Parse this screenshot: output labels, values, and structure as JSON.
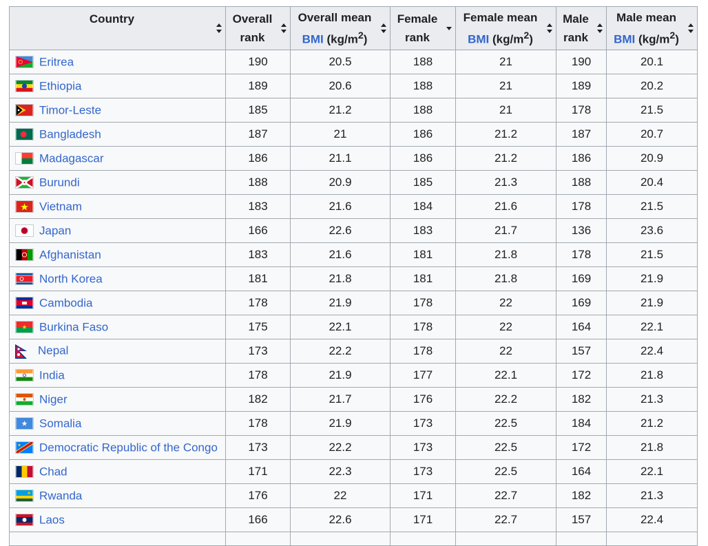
{
  "table": {
    "headers": [
      {
        "lines": [
          "Country"
        ],
        "sort": "both"
      },
      {
        "lines": [
          "Overall",
          "rank"
        ],
        "sort": "both"
      },
      {
        "lines": [
          "Overall mean"
        ],
        "bmi": true,
        "sort": "both"
      },
      {
        "lines": [
          "Female",
          "rank"
        ],
        "sort": "desc"
      },
      {
        "lines": [
          "Female mean"
        ],
        "bmi": true,
        "sort": "both"
      },
      {
        "lines": [
          "Male",
          "rank"
        ],
        "sort": "both"
      },
      {
        "lines": [
          "Male mean"
        ],
        "bmi": true,
        "sort": "both"
      }
    ],
    "bmi_link": "BMI",
    "bmi_unit": "(kg/m",
    "bmi_unit_sup": "2",
    "bmi_unit_close": ")",
    "rows": [
      {
        "country": "Eritrea",
        "flag": "eritrea-flag-icon",
        "overall_rank": "190",
        "overall_mean": "20.5",
        "female_rank": "188",
        "female_mean": "21",
        "male_rank": "190",
        "male_mean": "20.1"
      },
      {
        "country": "Ethiopia",
        "flag": "ethiopia-flag-icon",
        "overall_rank": "189",
        "overall_mean": "20.6",
        "female_rank": "188",
        "female_mean": "21",
        "male_rank": "189",
        "male_mean": "20.2"
      },
      {
        "country": "Timor-Leste",
        "flag": "timor-leste-flag-icon",
        "overall_rank": "185",
        "overall_mean": "21.2",
        "female_rank": "188",
        "female_mean": "21",
        "male_rank": "178",
        "male_mean": "21.5"
      },
      {
        "country": "Bangladesh",
        "flag": "bangladesh-flag-icon",
        "overall_rank": "187",
        "overall_mean": "21",
        "female_rank": "186",
        "female_mean": "21.2",
        "male_rank": "187",
        "male_mean": "20.7"
      },
      {
        "country": "Madagascar",
        "flag": "madagascar-flag-icon",
        "overall_rank": "186",
        "overall_mean": "21.1",
        "female_rank": "186",
        "female_mean": "21.2",
        "male_rank": "186",
        "male_mean": "20.9"
      },
      {
        "country": "Burundi",
        "flag": "burundi-flag-icon",
        "overall_rank": "188",
        "overall_mean": "20.9",
        "female_rank": "185",
        "female_mean": "21.3",
        "male_rank": "188",
        "male_mean": "20.4"
      },
      {
        "country": "Vietnam",
        "flag": "vietnam-flag-icon",
        "overall_rank": "183",
        "overall_mean": "21.6",
        "female_rank": "184",
        "female_mean": "21.6",
        "male_rank": "178",
        "male_mean": "21.5"
      },
      {
        "country": "Japan",
        "flag": "japan-flag-icon",
        "overall_rank": "166",
        "overall_mean": "22.6",
        "female_rank": "183",
        "female_mean": "21.7",
        "male_rank": "136",
        "male_mean": "23.6"
      },
      {
        "country": "Afghanistan",
        "flag": "afghanistan-flag-icon",
        "overall_rank": "183",
        "overall_mean": "21.6",
        "female_rank": "181",
        "female_mean": "21.8",
        "male_rank": "178",
        "male_mean": "21.5"
      },
      {
        "country": "North Korea",
        "flag": "north-korea-flag-icon",
        "overall_rank": "181",
        "overall_mean": "21.8",
        "female_rank": "181",
        "female_mean": "21.8",
        "male_rank": "169",
        "male_mean": "21.9"
      },
      {
        "country": "Cambodia",
        "flag": "cambodia-flag-icon",
        "overall_rank": "178",
        "overall_mean": "21.9",
        "female_rank": "178",
        "female_mean": "22",
        "male_rank": "169",
        "male_mean": "21.9"
      },
      {
        "country": "Burkina Faso",
        "flag": "burkina-faso-flag-icon",
        "overall_rank": "175",
        "overall_mean": "22.1",
        "female_rank": "178",
        "female_mean": "22",
        "male_rank": "164",
        "male_mean": "22.1"
      },
      {
        "country": "Nepal",
        "flag": "nepal-flag-icon",
        "overall_rank": "173",
        "overall_mean": "22.2",
        "female_rank": "178",
        "female_mean": "22",
        "male_rank": "157",
        "male_mean": "22.4"
      },
      {
        "country": "India",
        "flag": "india-flag-icon",
        "overall_rank": "178",
        "overall_mean": "21.9",
        "female_rank": "177",
        "female_mean": "22.1",
        "male_rank": "172",
        "male_mean": "21.8"
      },
      {
        "country": "Niger",
        "flag": "niger-flag-icon",
        "overall_rank": "182",
        "overall_mean": "21.7",
        "female_rank": "176",
        "female_mean": "22.2",
        "male_rank": "182",
        "male_mean": "21.3"
      },
      {
        "country": "Somalia",
        "flag": "somalia-flag-icon",
        "overall_rank": "178",
        "overall_mean": "21.9",
        "female_rank": "173",
        "female_mean": "22.5",
        "male_rank": "184",
        "male_mean": "21.2"
      },
      {
        "country": "Democratic Republic of the Congo",
        "flag": "drc-flag-icon",
        "overall_rank": "173",
        "overall_mean": "22.2",
        "female_rank": "173",
        "female_mean": "22.5",
        "male_rank": "172",
        "male_mean": "21.8"
      },
      {
        "country": "Chad",
        "flag": "chad-flag-icon",
        "overall_rank": "171",
        "overall_mean": "22.3",
        "female_rank": "173",
        "female_mean": "22.5",
        "male_rank": "164",
        "male_mean": "22.1"
      },
      {
        "country": "Rwanda",
        "flag": "rwanda-flag-icon",
        "overall_rank": "176",
        "overall_mean": "22",
        "female_rank": "171",
        "female_mean": "22.7",
        "male_rank": "182",
        "male_mean": "21.3"
      },
      {
        "country": "Laos",
        "flag": "laos-flag-icon",
        "overall_rank": "166",
        "overall_mean": "22.6",
        "female_rank": "171",
        "female_mean": "22.7",
        "male_rank": "157",
        "male_mean": "22.4"
      }
    ]
  }
}
